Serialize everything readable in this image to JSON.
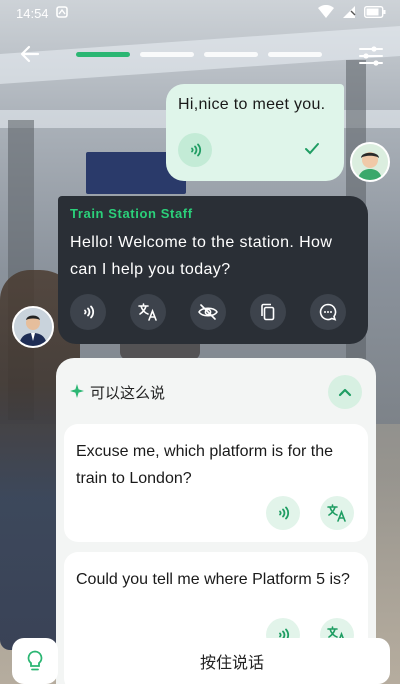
{
  "status": {
    "time": "14:54"
  },
  "progress": {
    "total": 4,
    "current": 1
  },
  "user_message": {
    "text": "Hi,nice to meet you."
  },
  "staff_message": {
    "speaker": "Train Station Staff",
    "text": "Hello! Welcome to the station. How can I help you today?"
  },
  "suggestions": {
    "title": "可以这么说",
    "items": [
      {
        "text": "Excuse me, which platform is for the train to London?"
      },
      {
        "text": "Could you tell me where Platform 5 is?"
      }
    ]
  },
  "bottom": {
    "hold_label": "按住说话"
  },
  "colors": {
    "accent": "#2bb673",
    "staff_bubble": "#2a2f36",
    "user_bubble": "#dff5ea"
  },
  "icons": [
    "back-arrow-icon",
    "settings-sliders-icon",
    "speaker-icon",
    "check-icon",
    "translate-icon",
    "hide-icon",
    "copy-icon",
    "chat-feedback-icon",
    "sparkle-icon",
    "chevron-up-icon",
    "lightbulb-icon"
  ]
}
